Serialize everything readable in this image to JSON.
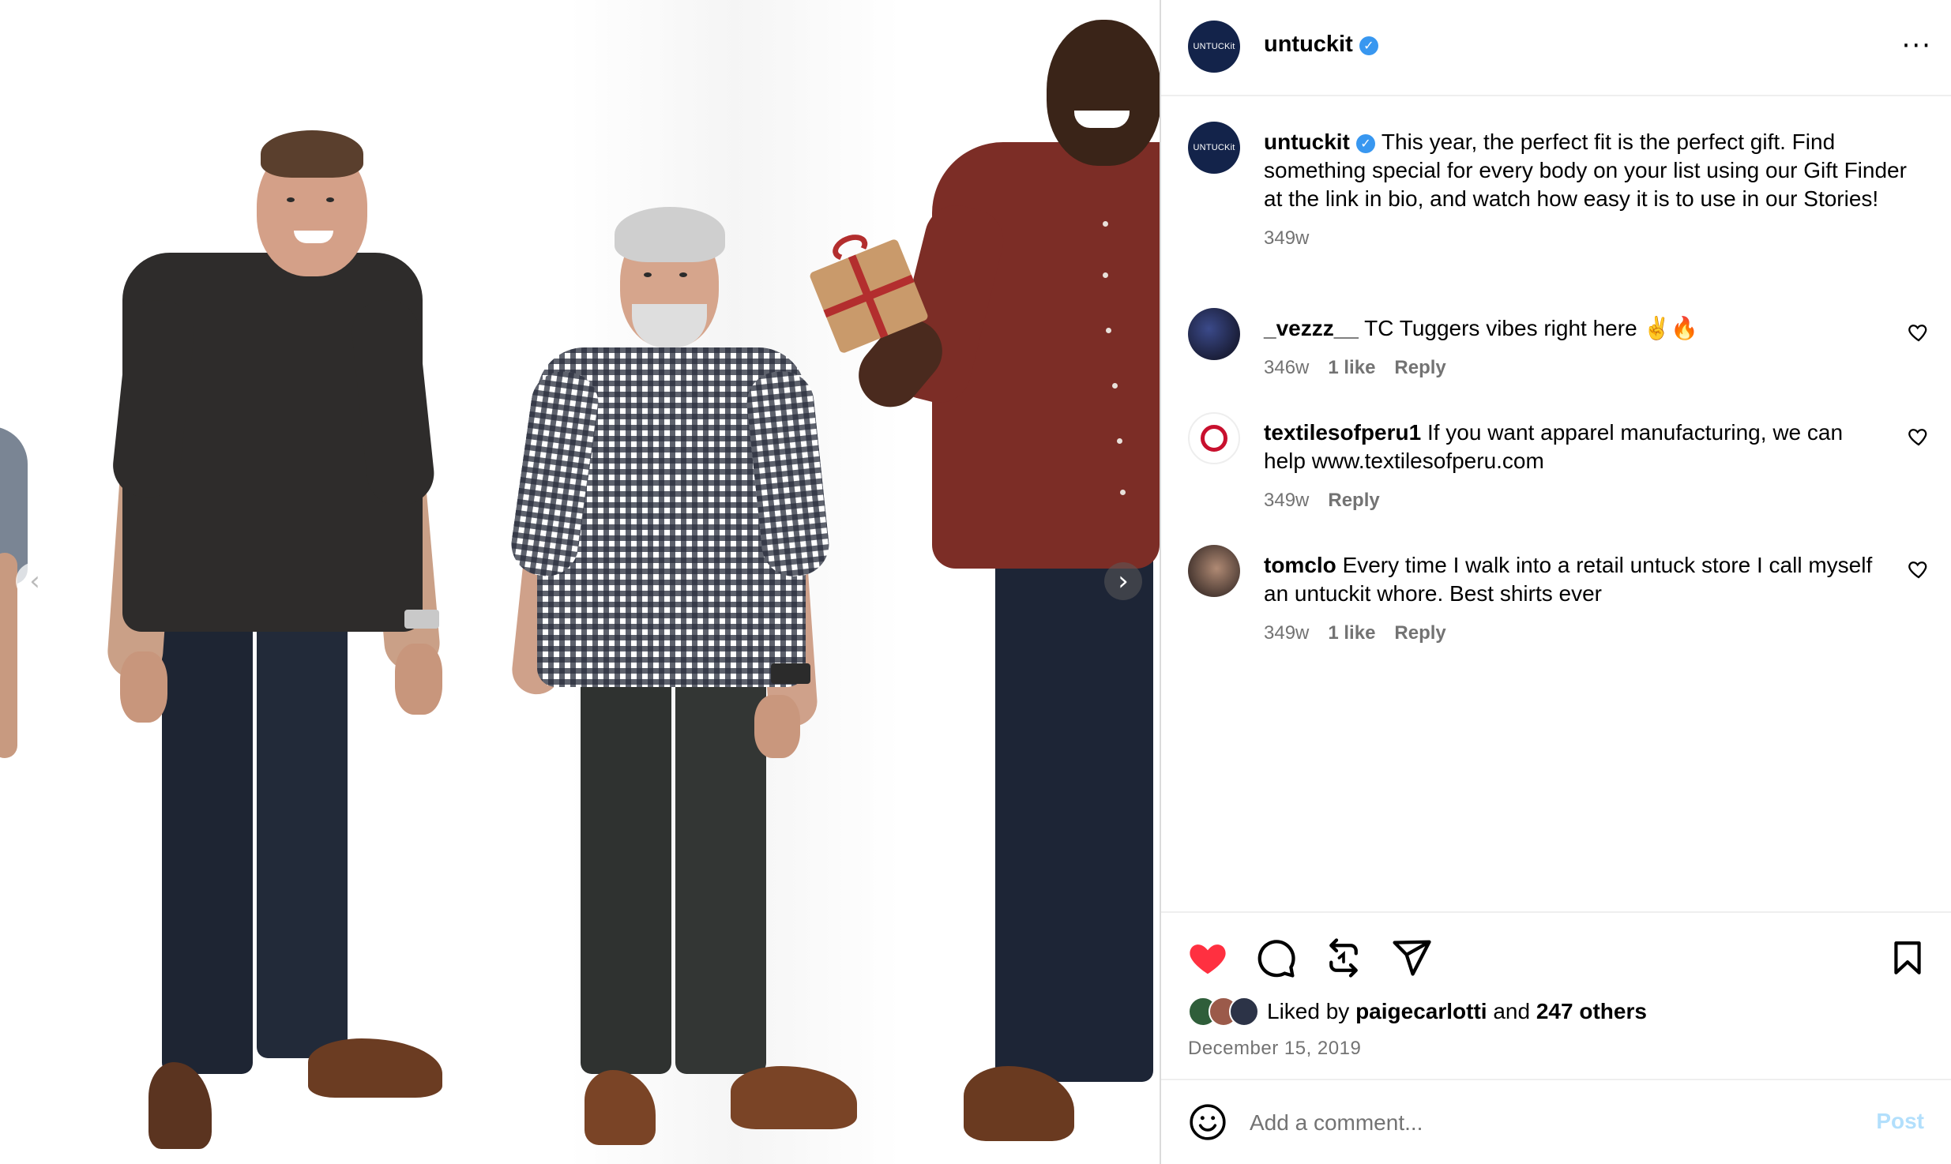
{
  "post": {
    "username": "untuckit",
    "avatar_text": "UNTUCKit",
    "more_icon": "more-horizontal-icon",
    "caption": "This year, the perfect fit is the perfect gift. Find something special for every body on your list using our Gift Finder at the link in bio, and watch how easy it is to use in our Stories!",
    "caption_time": "349w"
  },
  "media": {
    "prev_icon": "‹",
    "next_icon": "›"
  },
  "comments": [
    {
      "username": "_vezzz__",
      "text": "TC Tuggers vibes right here ✌️🔥",
      "time": "346w",
      "likes": "1 like",
      "reply": "Reply"
    },
    {
      "username": "textilesofperu1",
      "text": "If you want apparel manufacturing, we can help www.textilesofperu.com",
      "time": "349w",
      "likes": "",
      "reply": "Reply"
    },
    {
      "username": "tomclo",
      "text": "Every time I walk into a retail untuck store I call myself an untuckit whore. Best shirts ever",
      "time": "349w",
      "likes": "1 like",
      "reply": "Reply"
    }
  ],
  "actions": {
    "like_icon": "heart-filled-icon",
    "comment_icon": "comment-icon",
    "repost_icon": "repost-icon",
    "share_icon": "send-icon",
    "save_icon": "bookmark-icon",
    "liked_prefix": "Liked by",
    "liked_user": "paigecarlotti",
    "liked_and": "and",
    "liked_others": "247 others",
    "date": "December 15, 2019"
  },
  "add_comment": {
    "placeholder": "Add a comment...",
    "post_label": "Post"
  },
  "colors": {
    "accent": "#0095f6",
    "heart": "#ff3040",
    "verified": "#3897f0",
    "muted": "#737373"
  }
}
